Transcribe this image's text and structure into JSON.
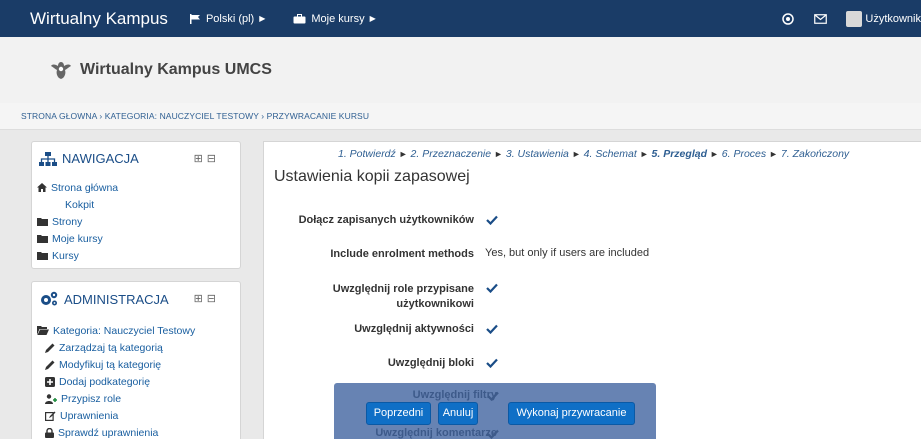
{
  "navbar": {
    "brand": "Wirtualny Kampus",
    "language": "Polski (pl)",
    "my_courses": "Moje kursy",
    "user": "Użytkownik"
  },
  "header": {
    "site_name": "Wirtualny Kampus UMCS"
  },
  "breadcrumb": "STRONA GŁOWNA › KATEGORIA: NAUCZYCIEL TESTOWY › PRZYWRACANIE KURSU",
  "navigation": {
    "title": "NAWIGACJA",
    "items": [
      {
        "label": "Strona główna",
        "icon": "home-icon"
      },
      {
        "label": "Kokpit"
      },
      {
        "label": "Strony",
        "icon": "folder-icon"
      },
      {
        "label": "Moje kursy",
        "icon": "folder-icon"
      },
      {
        "label": "Kursy",
        "icon": "folder-icon"
      }
    ]
  },
  "administration": {
    "title": "ADMINISTRACJA",
    "items": [
      {
        "label": "Kategoria: Nauczyciel Testowy",
        "icon": "folder-open-icon"
      },
      {
        "label": "Zarządzaj tą kategorią",
        "icon": "pencil-icon"
      },
      {
        "label": "Modyfikuj tą kategorię",
        "icon": "pencil-icon"
      },
      {
        "label": "Dodaj podkategorię",
        "icon": "plus-square-icon"
      },
      {
        "label": "Przypisz role",
        "icon": "add-user-icon"
      },
      {
        "label": "Uprawnienia",
        "icon": "edit-icon"
      },
      {
        "label": "Sprawdź uprawnienia",
        "icon": "lock-icon"
      }
    ]
  },
  "steps": {
    "s1": "1. Potwierdź",
    "s2": "2. Przeznaczenie",
    "s3": "3. Ustawienia",
    "s4": "4. Schemat",
    "s5": "5. Przegląd",
    "s6": "6. Proces",
    "s7": "7. Zakończony",
    "separator": "►"
  },
  "main": {
    "title": "Ustawienia kopii zapasowej",
    "settings": [
      {
        "label": "Dołącz zapisanych użytkowników",
        "value": "✔"
      },
      {
        "label": "Include enrolment methods",
        "value": "Yes, but only if users are included"
      },
      {
        "label_line1": "Uwzględnij role przypisane",
        "label_line2": "użytkownikowi",
        "value": "✔"
      },
      {
        "label": "Uwzględnij aktywności",
        "value": "✔"
      },
      {
        "label": "Uwzględnij bloki",
        "value": "✔"
      },
      {
        "label": "Uwzględnij filtry",
        "value": "✔"
      },
      {
        "label": "Uwzględnij komentarze",
        "value": "✔"
      }
    ]
  },
  "buttons": {
    "previous": "Poprzedni",
    "cancel": "Anuluj",
    "restore": "Wykonaj przywracanie"
  },
  "colors": {
    "navbar": "#1a3c67",
    "link": "#1a5fa0",
    "button": "#0f6fc6",
    "overlay": "#5a78ac"
  }
}
